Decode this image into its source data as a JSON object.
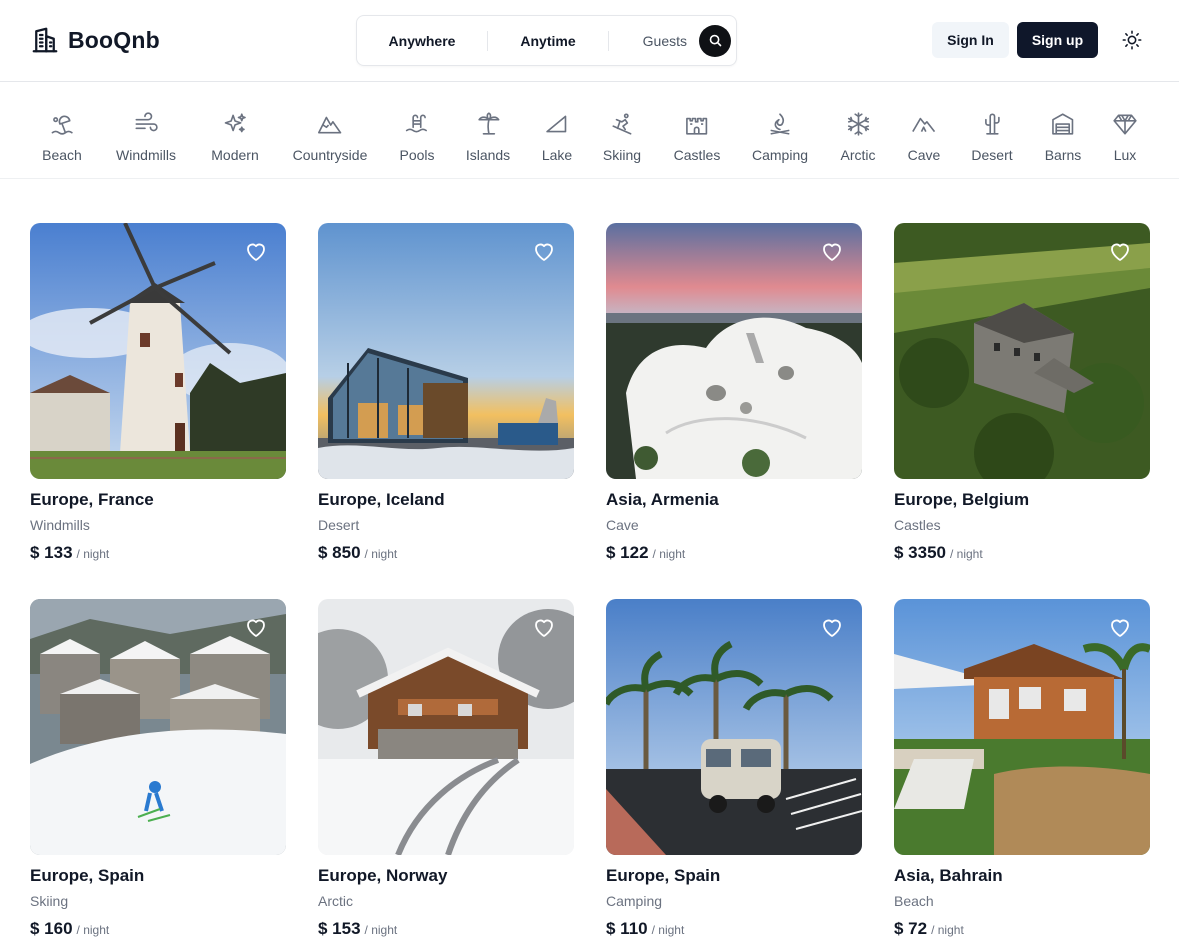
{
  "brand": {
    "name": "BooQnb"
  },
  "search": {
    "anywhere": "Anywhere",
    "anytime": "Anytime",
    "guests": "Guests"
  },
  "auth": {
    "sign_in": "Sign In",
    "sign_up": "Sign up"
  },
  "categories": [
    {
      "label": "Beach",
      "icon": "beach-icon"
    },
    {
      "label": "Windmills",
      "icon": "wind-icon"
    },
    {
      "label": "Modern",
      "icon": "sparkles-icon"
    },
    {
      "label": "Countryside",
      "icon": "mountain-icon"
    },
    {
      "label": "Pools",
      "icon": "pool-icon"
    },
    {
      "label": "Islands",
      "icon": "palm-icon"
    },
    {
      "label": "Lake",
      "icon": "lake-icon"
    },
    {
      "label": "Skiing",
      "icon": "skiing-icon"
    },
    {
      "label": "Castles",
      "icon": "castle-icon"
    },
    {
      "label": "Camping",
      "icon": "campfire-icon"
    },
    {
      "label": "Arctic",
      "icon": "snowflake-icon"
    },
    {
      "label": "Cave",
      "icon": "cave-icon"
    },
    {
      "label": "Desert",
      "icon": "cactus-icon"
    },
    {
      "label": "Barns",
      "icon": "barn-icon"
    },
    {
      "label": "Lux",
      "icon": "diamond-icon"
    }
  ],
  "listings": [
    {
      "location": "Europe, France",
      "category": "Windmills",
      "price": "$ 133",
      "unit": "/ night"
    },
    {
      "location": "Europe, Iceland",
      "category": "Desert",
      "price": "$ 850",
      "unit": "/ night"
    },
    {
      "location": "Asia, Armenia",
      "category": "Cave",
      "price": "$ 122",
      "unit": "/ night"
    },
    {
      "location": "Europe, Belgium",
      "category": "Castles",
      "price": "$ 3350",
      "unit": "/ night"
    },
    {
      "location": "Europe, Spain",
      "category": "Skiing",
      "price": "$ 160",
      "unit": "/ night"
    },
    {
      "location": "Europe, Norway",
      "category": "Arctic",
      "price": "$ 153",
      "unit": "/ night"
    },
    {
      "location": "Europe, Spain",
      "category": "Camping",
      "price": "$ 110",
      "unit": "/ night"
    },
    {
      "location": "Asia, Bahrain",
      "category": "Beach",
      "price": "$ 72",
      "unit": "/ night"
    }
  ],
  "colors": {
    "primary_dark": "#0f172a",
    "signin_bg": "#f1f5f9",
    "text_muted": "#6b7280",
    "border": "#e5e7eb"
  }
}
